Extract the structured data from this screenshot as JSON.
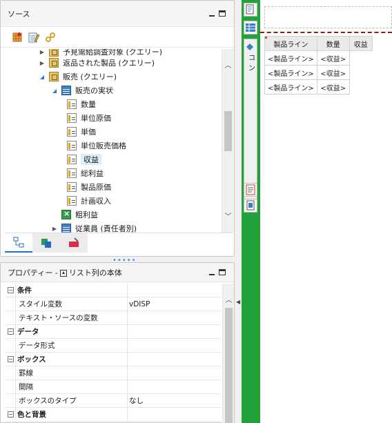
{
  "source_panel": {
    "title": "ソース",
    "tree": [
      {
        "label": "予見需給調査対象 (クエリー)",
        "level": 2,
        "icon": "query-icon",
        "expander": "collapsed"
      },
      {
        "label": "返品された製品 (クエリー)",
        "level": 2,
        "icon": "query-icon",
        "expander": "collapsed"
      },
      {
        "label": "販売 (クエリー)",
        "level": 2,
        "icon": "query-icon",
        "expander": "expanded"
      },
      {
        "label": "販売の実状",
        "level": 3,
        "icon": "table-icon",
        "expander": "expanded"
      },
      {
        "label": "数量",
        "level": 4,
        "icon": "fact-icon",
        "expander": "none"
      },
      {
        "label": "単位原価",
        "level": 4,
        "icon": "fact-icon",
        "expander": "none"
      },
      {
        "label": "単価",
        "level": 4,
        "icon": "fact-icon",
        "expander": "none"
      },
      {
        "label": "単位販売価格",
        "level": 4,
        "icon": "fact-icon",
        "expander": "none"
      },
      {
        "label": "収益",
        "level": 4,
        "icon": "fact-icon",
        "expander": "none",
        "selected": true
      },
      {
        "label": "総利益",
        "level": 4,
        "icon": "fact-icon",
        "expander": "none"
      },
      {
        "label": "製品原価",
        "level": 4,
        "icon": "fact-icon",
        "expander": "none"
      },
      {
        "label": "計画収入",
        "level": 4,
        "icon": "fact-icon",
        "expander": "none"
      },
      {
        "label": "粗利益",
        "level": 3,
        "icon": "calc-icon",
        "expander": "none"
      },
      {
        "label": "従業員 (責任者別)",
        "level": 3,
        "icon": "table-icon",
        "expander": "collapsed"
      }
    ]
  },
  "properties_panel": {
    "title": "プロパティー - ",
    "selected_object": "リスト列の本体",
    "rows": [
      {
        "type": "group",
        "name": "条件",
        "value": ""
      },
      {
        "type": "item",
        "name": "スタイル変数",
        "value": "vDISP"
      },
      {
        "type": "item",
        "name": "テキスト・ソースの変数",
        "value": ""
      },
      {
        "type": "group",
        "name": "データ",
        "value": ""
      },
      {
        "type": "item",
        "name": "データ形式",
        "value": ""
      },
      {
        "type": "group",
        "name": "ボックス",
        "value": ""
      },
      {
        "type": "item",
        "name": "罫線",
        "value": ""
      },
      {
        "type": "item",
        "name": "間隔",
        "value": ""
      },
      {
        "type": "item",
        "name": "ボックスのタイプ",
        "value": "なし"
      },
      {
        "type": "group",
        "name": "色と背景",
        "value": ""
      }
    ]
  },
  "report": {
    "side_label": "コン",
    "list_table": {
      "headers": [
        "製品ライン",
        "数量",
        "収益"
      ],
      "rows": [
        [
          "<製品ライン>",
          "<収益>"
        ],
        [
          "<製品ライン>",
          "<収益>"
        ],
        [
          "<製品ライン>",
          "<収益>"
        ]
      ]
    }
  },
  "colors": {
    "green_strip": "#22a23a",
    "selection": "#e0eef8",
    "tab_accent": "#1e70c8",
    "page_break": "#8b1a1a"
  }
}
